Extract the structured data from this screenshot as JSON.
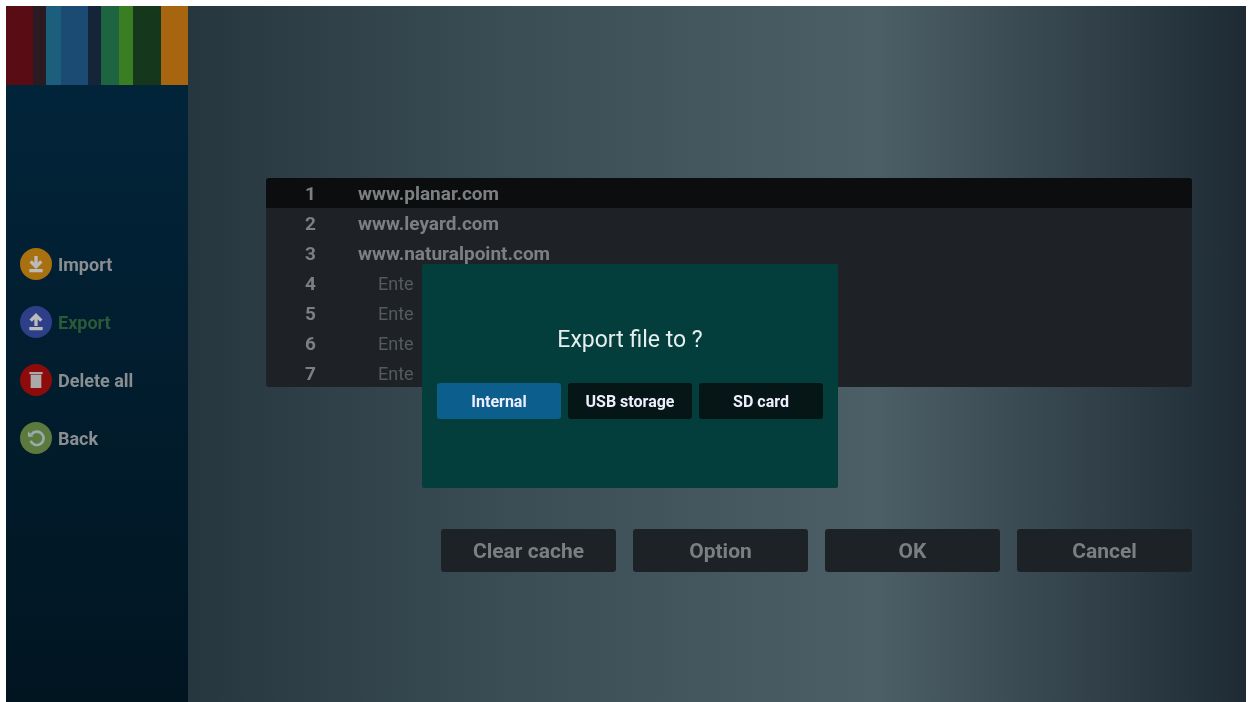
{
  "sidebar": {
    "items": [
      {
        "label": "Import",
        "selected": false
      },
      {
        "label": "Export",
        "selected": true
      },
      {
        "label": "Delete all",
        "selected": false
      },
      {
        "label": "Back",
        "selected": false
      }
    ]
  },
  "list": {
    "rows": [
      {
        "number": "1",
        "text": "www.planar.com",
        "kind": "url",
        "selected": true
      },
      {
        "number": "2",
        "text": "www.leyard.com",
        "kind": "url",
        "selected": false
      },
      {
        "number": "3",
        "text": "www.naturalpoint.com",
        "kind": "url",
        "selected": false
      },
      {
        "number": "4",
        "text": "Ente",
        "kind": "placeholder",
        "selected": false
      },
      {
        "number": "5",
        "text": "Ente",
        "kind": "placeholder",
        "selected": false
      },
      {
        "number": "6",
        "text": "Ente",
        "kind": "placeholder",
        "selected": false
      },
      {
        "number": "7",
        "text": "Ente",
        "kind": "placeholder",
        "selected": false
      }
    ]
  },
  "buttons": [
    "Clear cache",
    "Option",
    "OK",
    "Cancel"
  ],
  "dialog": {
    "title": "Export file to ?",
    "options": [
      {
        "label": "Internal",
        "selected": true
      },
      {
        "label": "USB storage",
        "selected": false
      },
      {
        "label": "SD card",
        "selected": false
      }
    ]
  }
}
